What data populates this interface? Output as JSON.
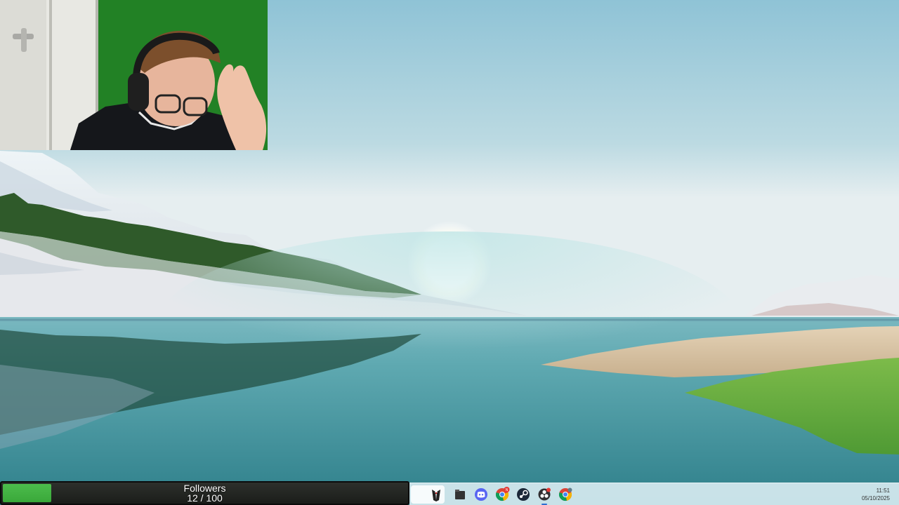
{
  "follower_goal": {
    "title": "Followers",
    "count_text": "12 / 100",
    "progress_fraction": 0.12,
    "fill_color": "#4cbc4c"
  },
  "taskbar": {
    "apps": [
      {
        "name": "obs-tuxedo-icon",
        "active": false
      },
      {
        "name": "file-explorer-icon",
        "active": false
      },
      {
        "name": "discord-icon",
        "active": false
      },
      {
        "name": "chrome-icon",
        "active": false,
        "badge": "N"
      },
      {
        "name": "steam-icon",
        "active": false
      },
      {
        "name": "obs-studio-icon",
        "active": true
      },
      {
        "name": "chrome-alt-icon",
        "active": false
      }
    ],
    "clock": {
      "time": "11:51",
      "date": "05/10/2025"
    }
  },
  "colors": {
    "sky_top": "#8fc3d6",
    "sky_horizon": "#e6eef0",
    "water": "#4e9ea6",
    "webcam_green_screen": "#1e7a22"
  }
}
